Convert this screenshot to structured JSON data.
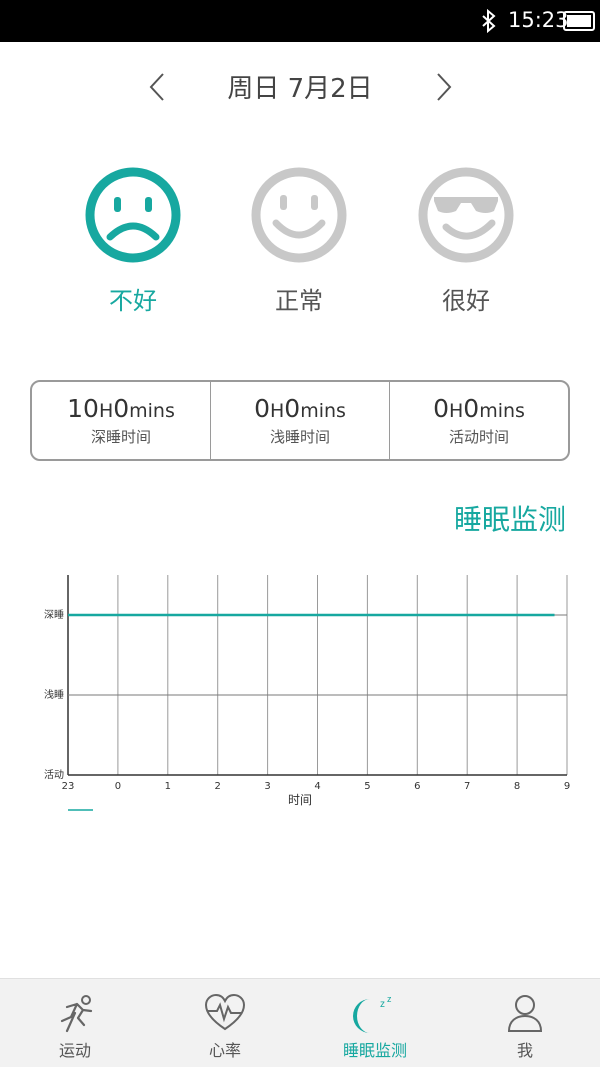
{
  "status_bar": {
    "time": "15:23",
    "bluetooth_icon": "bluetooth-icon",
    "battery_icon": "battery-full-icon"
  },
  "date_nav": {
    "label": "周日  7月2日",
    "prev_icon": "chevron-left-icon",
    "next_icon": "chevron-right-icon"
  },
  "moods": [
    {
      "label": "不好",
      "icon": "sad-face-icon",
      "active": true
    },
    {
      "label": "正常",
      "icon": "smile-face-icon",
      "active": false
    },
    {
      "label": "很好",
      "icon": "sunglasses-face-icon",
      "active": false
    }
  ],
  "stats": [
    {
      "hours": "10",
      "h_unit": "H",
      "mins": "0",
      "m_unit": "mins",
      "caption": "深睡时间"
    },
    {
      "hours": "0",
      "h_unit": "H",
      "mins": "0",
      "m_unit": "mins",
      "caption": "浅睡时间"
    },
    {
      "hours": "0",
      "h_unit": "H",
      "mins": "0",
      "m_unit": "mins",
      "caption": "活动时间"
    }
  ],
  "section_title": "睡眠监测",
  "colors": {
    "accent": "#17a8a0",
    "inactive": "#c8c8c8"
  },
  "chart_data": {
    "type": "line",
    "xlabel": "时间",
    "ylabel": "",
    "x_ticks": [
      "23",
      "0",
      "1",
      "2",
      "3",
      "4",
      "5",
      "6",
      "7",
      "8",
      "9"
    ],
    "y_categories": [
      "活动",
      "浅睡",
      "深睡"
    ],
    "series": [
      {
        "x": [
          "23",
          "8:45"
        ],
        "values": [
          "深睡",
          "深睡"
        ],
        "color": "#17a8a0"
      }
    ],
    "grid": true
  },
  "tabs": [
    {
      "label": "运动",
      "icon": "running-icon",
      "active": false
    },
    {
      "label": "心率",
      "icon": "heart-rate-icon",
      "active": false
    },
    {
      "label": "睡眠监测",
      "icon": "sleep-moon-icon",
      "active": true
    },
    {
      "label": "我",
      "icon": "user-icon",
      "active": false
    }
  ]
}
